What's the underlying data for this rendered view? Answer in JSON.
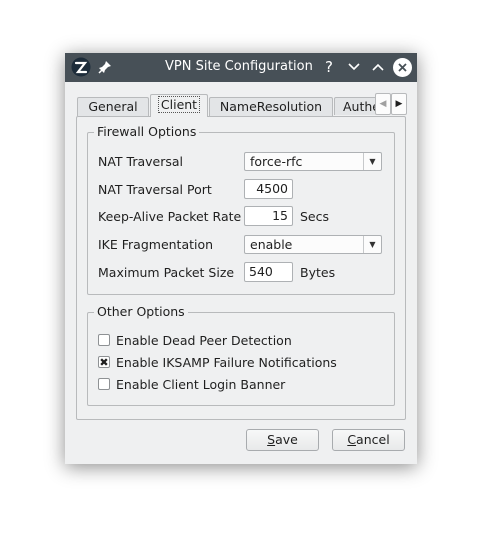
{
  "window": {
    "title": "VPN Site Configuration",
    "buttons": {
      "help": "?",
      "minimize": "⌄",
      "maximize": "⌃",
      "close": "✕"
    }
  },
  "tabs": [
    {
      "label": "General",
      "active": false
    },
    {
      "label": "Client",
      "active": true
    },
    {
      "label": "NameResolution",
      "active": false
    },
    {
      "label": "Authe",
      "active": false
    }
  ],
  "tab_scroll": {
    "left": "◀",
    "right": "▶"
  },
  "firewall": {
    "title": "Firewall Options",
    "nat_traversal": {
      "label": "NAT Traversal",
      "value": "force-rfc",
      "arrow": "▼"
    },
    "nat_port": {
      "label": "NAT Traversal Port",
      "value": "4500"
    },
    "keepalive": {
      "label": "Keep-Alive Packet Rate",
      "value": "15",
      "unit": "Secs"
    },
    "ike_frag": {
      "label": "IKE Fragmentation",
      "value": "enable",
      "arrow": "▼"
    },
    "max_packet": {
      "label": "Maximum Packet Size",
      "value": "540",
      "unit": "Bytes"
    }
  },
  "other": {
    "title": "Other Options",
    "dpd": {
      "label": "Enable Dead Peer Detection",
      "checked": false,
      "mark": ""
    },
    "iksamp": {
      "label": "Enable IKSAMP Failure Notifications",
      "checked": true,
      "mark": "✖"
    },
    "banner": {
      "label": "Enable Client Login Banner",
      "checked": false,
      "mark": ""
    }
  },
  "actions": {
    "save": {
      "mnemonic": "S",
      "rest": "ave"
    },
    "cancel": {
      "mnemonic": "C",
      "rest": "ancel"
    }
  },
  "colors": {
    "titlebar": "#475057",
    "window_bg": "#eff0f1",
    "border": "#b8babc"
  }
}
